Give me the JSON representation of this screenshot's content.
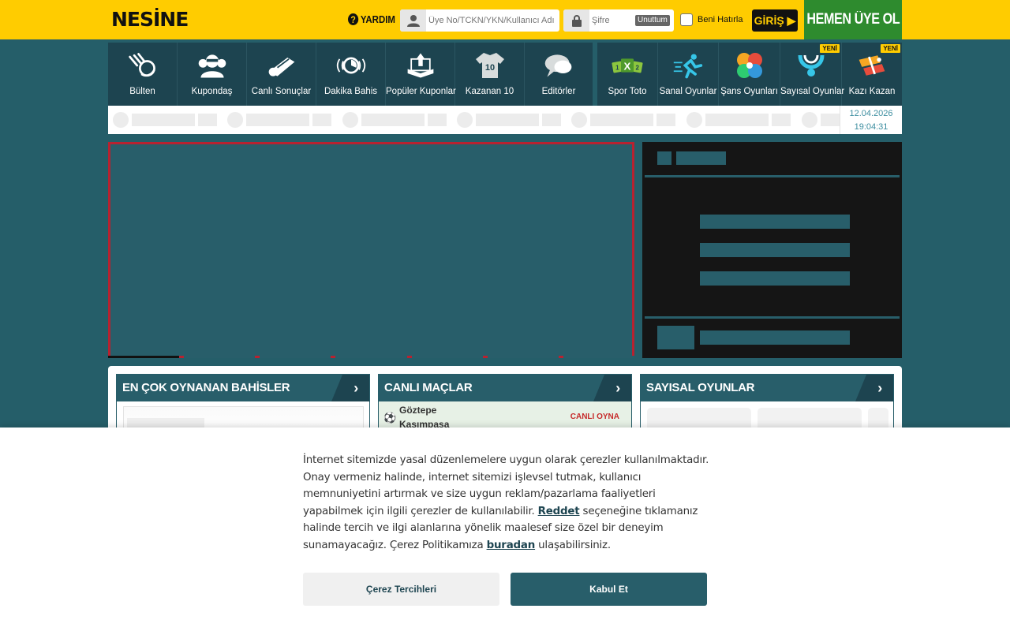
{
  "header": {
    "logo": "NESİNE",
    "help_label": "YARDIM",
    "username_placeholder": "Üye No/TCKN/YKN/Kullanıcı Adı",
    "password_placeholder": "Şifre",
    "forgot_label": "Unuttum",
    "remember_label": "Beni Hatırla",
    "login_label": "GİRİŞ ▶",
    "signup_label": "HEMEN ÜYE OL"
  },
  "nav_left": [
    {
      "label": "Bülten",
      "icon": "bulletin-icon"
    },
    {
      "label": "Kupondaş",
      "icon": "group-icon"
    },
    {
      "label": "Canlı Sonuçlar",
      "icon": "whistle-icon"
    },
    {
      "label": "Dakika Bahis",
      "icon": "stopwatch-icon"
    },
    {
      "label": "Popüler Kuponlar",
      "icon": "popular-coupon-icon"
    },
    {
      "label": "Kazanan 10",
      "icon": "jersey-icon",
      "jersey_number": "10"
    },
    {
      "label": "Editörler",
      "icon": "chat-icon"
    }
  ],
  "nav_right": [
    {
      "label": "Spor Toto",
      "icon": "spor-toto-icon",
      "badge": ""
    },
    {
      "label": "Sanal Oyunlar",
      "icon": "runner-icon",
      "badge": ""
    },
    {
      "label": "Şans Oyunları",
      "icon": "clover-icon",
      "badge": ""
    },
    {
      "label": "Sayısal Oyunlar",
      "icon": "lottery-icon",
      "badge": "YENİ"
    },
    {
      "label": "Kazı Kazan",
      "icon": "scratch-icon",
      "badge": "YENİ"
    }
  ],
  "datetime": {
    "date": "12.04.2026",
    "time": "19:04:31"
  },
  "panels": {
    "popular_bets": {
      "title": "EN ÇOK OYNANAN BAHİSLER"
    },
    "live_matches": {
      "title": "CANLI MAÇLAR",
      "match": {
        "home": "Göztepe",
        "away": "Kasımpaşa",
        "cta": "CANLI OYNA"
      }
    },
    "numeric_games": {
      "title": "SAYISAL OYUNLAR"
    }
  },
  "cookie": {
    "text_before_reject": "İnternet sitemizde yasal düzenlemelere uygun olarak çerezler kullanılmaktadır. Onay vermeniz halinde, internet sitemizi işlevsel tutmak, kullanıcı memnuniyetini artırmak ve size uygun reklam/pazarlama faaliyetleri yapabilmek için ilgili çerezler de kullanılabilir. ",
    "reject_link": "Reddet",
    "text_middle": " seçeneğine tıklamanız halinde tercih ve ilgi alanlarına yönelik maalesef size özel bir deneyim sunamayacağız. Çerez Politikamıza ",
    "policy_link": "buradan",
    "text_after": " ulaşabilirsiniz.",
    "preferences_button": "Çerez Tercihleri",
    "accept_button": "Kabul Et"
  },
  "colors": {
    "brand_yellow": "#ffcc00",
    "teal": "#285e6a",
    "dark_teal": "#1d4450",
    "signup_green": "#2e8b2e",
    "banner_red": "#b82230",
    "live_red": "#c62a2a"
  }
}
